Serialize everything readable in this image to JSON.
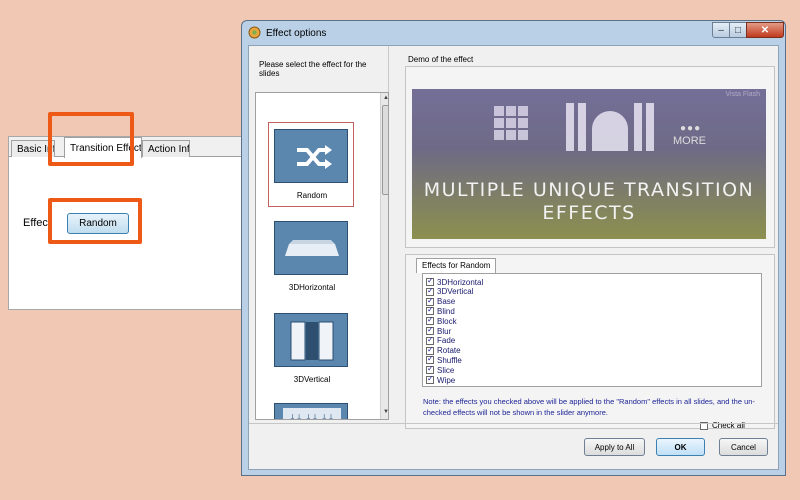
{
  "background_dialog": {
    "tabs": [
      "Basic Inf",
      "Transition Effect",
      "Action Info"
    ],
    "effect_label": "Effect",
    "effect_button": "Random"
  },
  "window": {
    "title": "Effect options",
    "controls": {
      "minimize": "–",
      "maximize": "□",
      "close": "✕"
    }
  },
  "left_pane": {
    "label": "Please select the effect for the slides",
    "effects": [
      {
        "name": "Random",
        "icon": "shuffle-icon",
        "selected": true
      },
      {
        "name": "3DHorizontal",
        "icon": "3d-horizontal-icon",
        "selected": false
      },
      {
        "name": "3DVertical",
        "icon": "3d-vertical-icon",
        "selected": false
      },
      {
        "name": "",
        "icon": "arrows-grid-icon",
        "selected": false
      }
    ]
  },
  "demo": {
    "label": "Demo of the effect",
    "watermark": "Vista Flash",
    "more_dots": "●●●",
    "more": "MORE",
    "headline_line1": "MULTIPLE UNIQUE TRANSITION",
    "headline_line2": "EFFECTS"
  },
  "effects_group": {
    "tab": "Effects for Random",
    "items": [
      {
        "label": "3DHorizontal",
        "checked": true
      },
      {
        "label": "3DVertical",
        "checked": true
      },
      {
        "label": "Base",
        "checked": true
      },
      {
        "label": "Blind",
        "checked": true
      },
      {
        "label": "Block",
        "checked": true
      },
      {
        "label": "Blur",
        "checked": true
      },
      {
        "label": "Fade",
        "checked": true
      },
      {
        "label": "Rotate",
        "checked": true
      },
      {
        "label": "Shuffle",
        "checked": true
      },
      {
        "label": "Slice",
        "checked": true
      },
      {
        "label": "Wipe",
        "checked": true
      }
    ],
    "note": "Note: the effects you checked above will be applied to the \"Random\" effects in all slides, and the un-checked effects will not be shown in the slider anymore.",
    "check_all": "Check all",
    "check_all_checked": false
  },
  "buttons": {
    "apply": "Apply to All",
    "ok": "OK",
    "cancel": "Cancel"
  },
  "colors": {
    "highlight": "#ee5a16",
    "background": "#f0c8b4",
    "thumb": "#5b86ae"
  }
}
